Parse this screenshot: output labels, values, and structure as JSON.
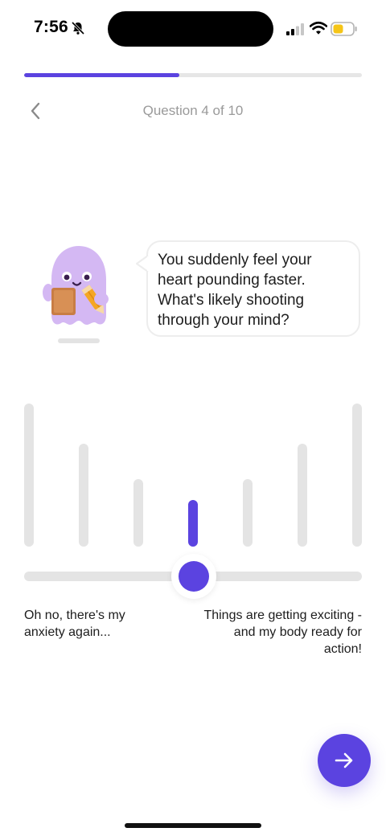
{
  "status_bar": {
    "time": "7:56",
    "icons": [
      "bell-slash-icon",
      "signal-icon",
      "wifi-icon",
      "battery-icon"
    ],
    "battery_color": "#f5c518"
  },
  "progress": {
    "current": 4,
    "total": 10,
    "fraction": 0.46,
    "color": "#5b43e0"
  },
  "header": {
    "back_icon": "chevron-left-icon",
    "question_label": "Question 4 of 10"
  },
  "prompt": {
    "text": "You suddenly feel your heart pounding faster. What's likely shooting through your mind?"
  },
  "scale": {
    "bar_count": 7,
    "selected_index": 3,
    "selected_value_fraction": 0.5
  },
  "labels": {
    "left": "Oh no, there's my anxiety again...",
    "right": "Things are getting exciting - and my body ready for action!"
  },
  "next_button": {
    "icon": "arrow-right-icon"
  },
  "colors": {
    "accent": "#5b43e0",
    "muted_bar": "#e4e4e4",
    "mascot": "#d4b8f3"
  }
}
